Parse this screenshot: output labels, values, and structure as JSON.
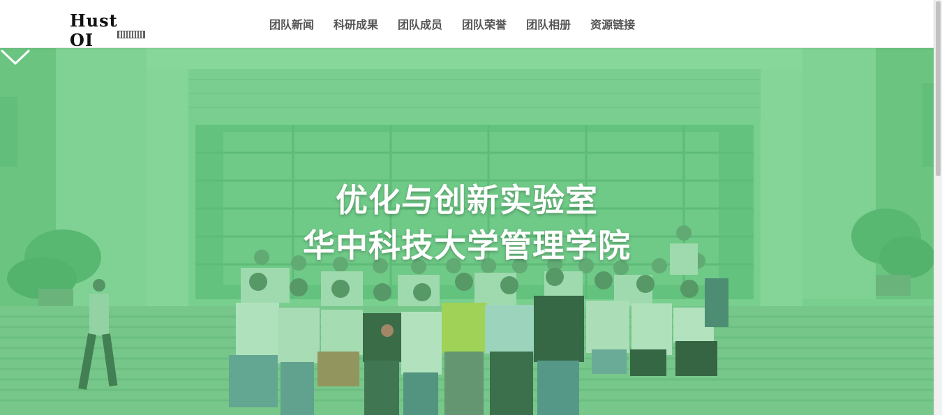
{
  "brand": {
    "logo_text": "Hust OI"
  },
  "nav": {
    "items": [
      {
        "label": "团队新闻"
      },
      {
        "label": "科研成果"
      },
      {
        "label": "团队成员"
      },
      {
        "label": "团队荣誉"
      },
      {
        "label": "团队相册"
      },
      {
        "label": "资源链接"
      }
    ]
  },
  "hero": {
    "title_line1": "优化与创新实验室",
    "title_line2": "华中科技大学管理学院",
    "overlay_color": "#4cc96e",
    "scroll_icon": "chevron-down-icon"
  }
}
